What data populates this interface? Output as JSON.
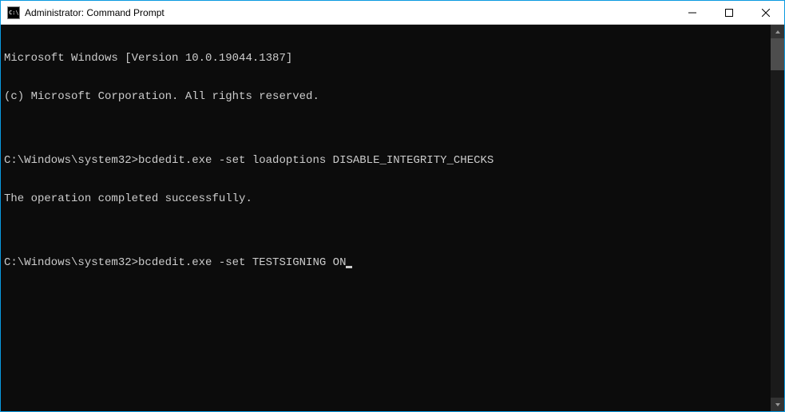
{
  "window": {
    "title": "Administrator: Command Prompt"
  },
  "terminal": {
    "lines": [
      "Microsoft Windows [Version 10.0.19044.1387]",
      "(c) Microsoft Corporation. All rights reserved.",
      "",
      "C:\\Windows\\system32>bcdedit.exe -set loadoptions DISABLE_INTEGRITY_CHECKS",
      "The operation completed successfully.",
      "",
      "C:\\Windows\\system32>bcdedit.exe -set TESTSIGNING ON"
    ]
  }
}
